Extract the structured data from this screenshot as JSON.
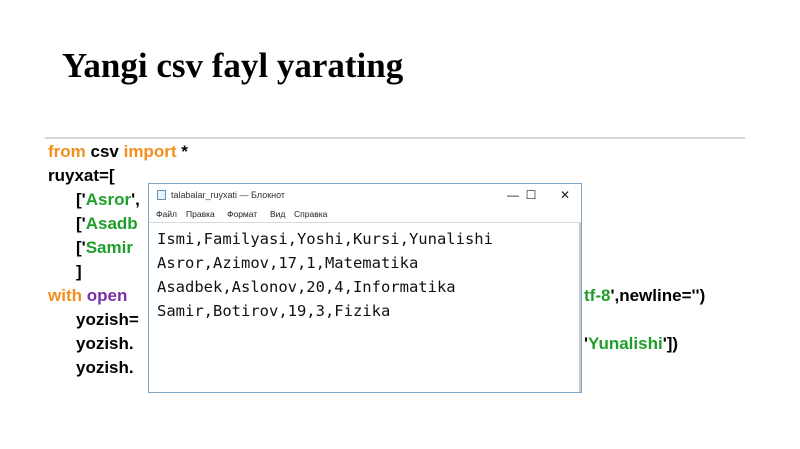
{
  "slide": {
    "title": "Yangi csv fayl yarating"
  },
  "code": {
    "line1_from": "from",
    "line1_csv": " csv ",
    "line1_import": "import",
    "line1_star": " *",
    "line2": "ruyxat=[",
    "line3_open": "['",
    "line3_str": "Asror",
    "line3_rest": "',",
    "line4_open": "['",
    "line4_str": "Asadb",
    "line5_open": "['",
    "line5_str": "Samir",
    "line6": "]",
    "line7_with": "with",
    "line7_open": " open",
    "line7_right_str": "tf-8",
    "line7_right_rest": "',newline='')",
    "line8": "yozish=",
    "line9": "yozish.",
    "line9_right_open": "'",
    "line9_right_str": "Yunalishi",
    "line9_right_rest": "'])",
    "line10": "yozish."
  },
  "notepad": {
    "title": "talabalar_ruyxati — Блокнот",
    "controls": {
      "minimize": "—",
      "maximize": "☐",
      "close": "✕"
    },
    "menu": [
      "Файл",
      "Правка",
      "Формат",
      "Вид",
      "Справка"
    ],
    "lines": [
      "Ismi,Familyasi,Yoshi,Kursi,Yunalishi",
      "Asror,Azimov,17,1,Matematika",
      "Asadbek,Aslonov,20,4,Informatika",
      "Samir,Botirov,19,3,Fizika"
    ]
  },
  "colors": {
    "keyword": "#f28e1c",
    "string": "#1f9e2c",
    "window_border": "#7fa6c9"
  }
}
